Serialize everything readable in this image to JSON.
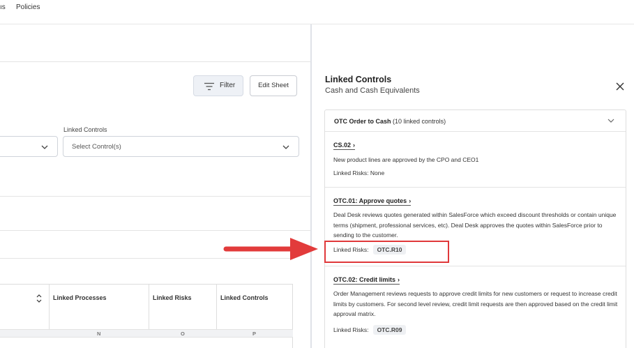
{
  "topnav": {
    "partial_item": "ıs",
    "policies": "Policies"
  },
  "toolbar": {
    "filter_label": "Filter",
    "edit_sheet_label": "Edit Sheet"
  },
  "filters": {
    "linked_controls_label": "Linked Controls",
    "linked_controls_placeholder": "Select Control(s)"
  },
  "table": {
    "headers": [
      "Linked Processes",
      "Linked Risks",
      "Linked Controls"
    ],
    "column_letters": [
      "N",
      "O",
      "P"
    ]
  },
  "panel": {
    "title": "Linked Controls",
    "subtitle": "Cash and Cash Equivalents",
    "group": {
      "name": "OTC Order to Cash",
      "count": "(10 linked controls)"
    },
    "linked_risks_label": "Linked Risks:",
    "controls": [
      {
        "title": "CS.02",
        "description": "New product lines are approved by the CPO and CEO1",
        "risks_text": "Linked Risks: None",
        "risk_chip": ""
      },
      {
        "title": "OTC.01: Approve quotes",
        "description": "Deal Desk reviews quotes generated within SalesForce which exceed discount thresholds or contain unique terms (shipment, professional services, etc). Deal Desk approves the quotes within SalesForce prior to sending to the customer.",
        "risks_text": "Linked Risks:",
        "risk_chip": "OTC.R10"
      },
      {
        "title": "OTC.02: Credit limits",
        "description": "Order Management reviews requests to approve credit limits for new customers or request to increase credit limits by customers. For second level review, credit limit requests are then approved based on the credit limit approval matrix.",
        "risks_text": "Linked Risks:",
        "risk_chip": "OTC.R09"
      }
    ]
  },
  "colors": {
    "highlight": "#e0383a",
    "arrow": "#e23b3b",
    "panel_divider": "#dfe2e8"
  },
  "icons": {
    "filter": "filter-lines-icon",
    "close": "close-icon",
    "chevron": "chevron-down-icon",
    "caret": "sort-caret-icon"
  }
}
